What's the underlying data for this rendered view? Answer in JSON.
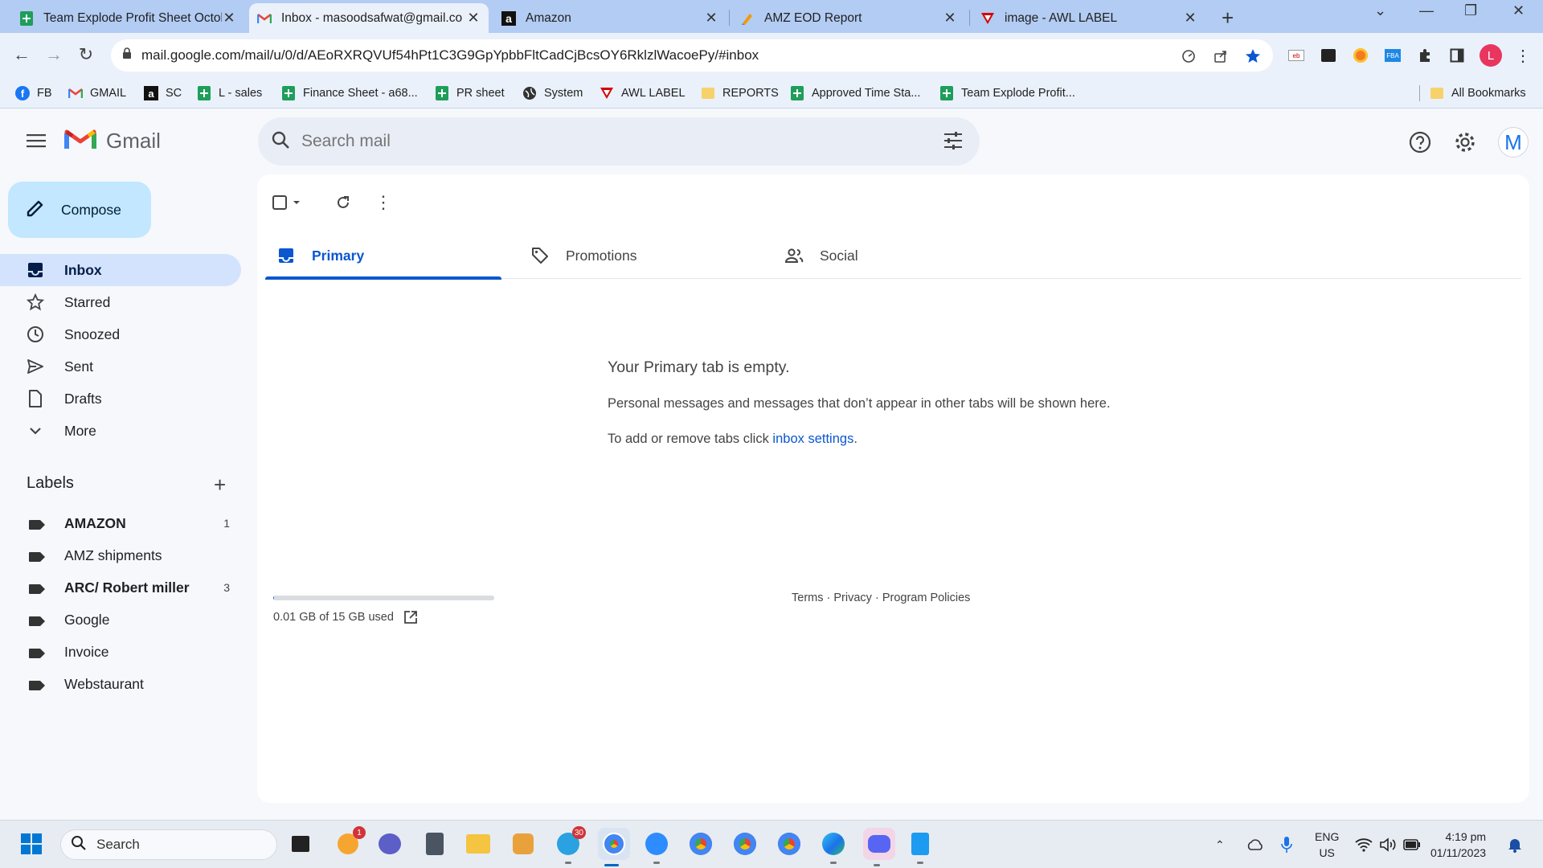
{
  "browser": {
    "tabs": [
      {
        "title": "Team Explode Profit Sheet Octob",
        "icon": "google-sheets-icon"
      },
      {
        "title": "Inbox - masoodsafwat@gmail.co",
        "icon": "gmail-icon"
      },
      {
        "title": "Amazon",
        "icon": "amazon-icon"
      },
      {
        "title": "AMZ EOD Report",
        "icon": "pen-icon"
      },
      {
        "title": "image - AWL LABEL",
        "icon": "awl-logo-icon"
      }
    ],
    "url": "mail.google.com/mail/u/0/d/AEoRXRQVUf54hPt1C3G9GpYpbbFltCadCjBcsOY6RklzlWacoePy/#inbox",
    "profile_initial": "L",
    "bookmarks": [
      {
        "label": "FB",
        "icon": "facebook-icon"
      },
      {
        "label": "GMAIL",
        "icon": "gmail-icon"
      },
      {
        "label": "SC",
        "icon": "amazon-icon"
      },
      {
        "label": "L - sales",
        "icon": "google-sheets-icon"
      },
      {
        "label": "Finance Sheet - a68...",
        "icon": "google-sheets-icon"
      },
      {
        "label": "PR sheet",
        "icon": "google-sheets-icon"
      },
      {
        "label": "System",
        "icon": "globe-icon"
      },
      {
        "label": "AWL LABEL",
        "icon": "awl-logo-icon"
      },
      {
        "label": "REPORTS",
        "icon": "folder-icon"
      },
      {
        "label": "Approved Time Sta...",
        "icon": "google-sheets-icon"
      },
      {
        "label": "Team Explode Profit...",
        "icon": "google-sheets-icon"
      }
    ],
    "all_bookmarks": "All Bookmarks"
  },
  "gmail": {
    "logo_text": "Gmail",
    "search_placeholder": "Search mail",
    "avatar_initial": "M",
    "compose_label": "Compose",
    "nav": [
      {
        "label": "Inbox",
        "icon": "inbox-icon",
        "active": true
      },
      {
        "label": "Starred",
        "icon": "star-icon"
      },
      {
        "label": "Snoozed",
        "icon": "clock-icon"
      },
      {
        "label": "Sent",
        "icon": "send-icon"
      },
      {
        "label": "Drafts",
        "icon": "draft-icon"
      },
      {
        "label": "More",
        "icon": "chevron-down-icon"
      }
    ],
    "labels_title": "Labels",
    "labels": [
      {
        "name": "AMAZON",
        "count": "1",
        "bold": true
      },
      {
        "name": "AMZ shipments",
        "count": "",
        "bold": false
      },
      {
        "name": "ARC/ Robert miller",
        "count": "3",
        "bold": true
      },
      {
        "name": "Google",
        "count": "",
        "bold": false
      },
      {
        "name": "Invoice",
        "count": "",
        "bold": false
      },
      {
        "name": "Webstaurant",
        "count": "",
        "bold": false
      }
    ],
    "inbox_tabs": [
      {
        "label": "Primary",
        "icon": "inbox-tab-icon",
        "active": true
      },
      {
        "label": "Promotions",
        "icon": "tag-icon"
      },
      {
        "label": "Social",
        "icon": "people-icon"
      }
    ],
    "empty": {
      "title": "Your Primary tab is empty.",
      "line1": "Personal messages and messages that don’t appear in other tabs will be shown here.",
      "line2_prefix": "To add or remove tabs click ",
      "line2_link": "inbox settings",
      "line2_suffix": "."
    },
    "storage": {
      "text": "0.01 GB of 15 GB used",
      "used_fraction": 0.0007
    },
    "footer": {
      "terms": "Terms",
      "sep": " · ",
      "privacy": "Privacy",
      "policies": "Program Policies"
    }
  },
  "taskbar": {
    "search_placeholder": "Search",
    "badges": {
      "weather": "1",
      "telegram": "30"
    },
    "lang_line1": "ENG",
    "lang_line2": "US",
    "time": "4:19 pm",
    "date": "01/11/2023"
  },
  "colors": {
    "accent": "#0b57d0",
    "compose": "#c2e7ff",
    "active_nav": "#d3e3fd",
    "tabstrip": "#b2ccf3"
  }
}
